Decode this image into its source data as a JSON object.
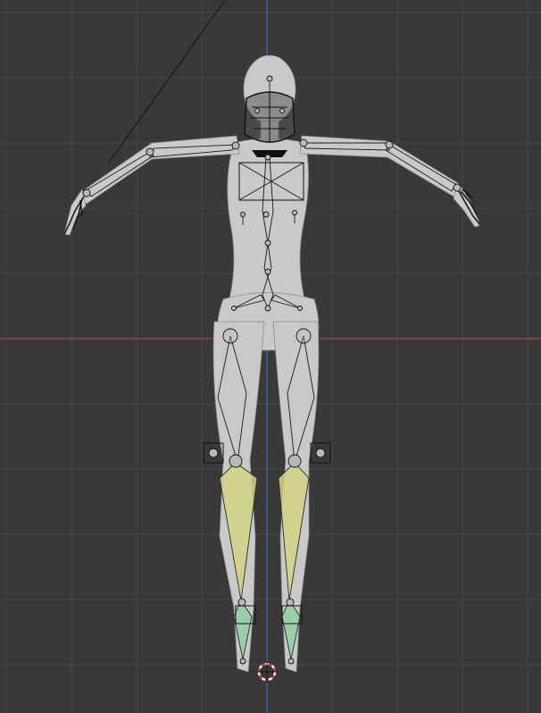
{
  "viewport": {
    "view": "front-orthographic",
    "grid": true,
    "colors": {
      "background": "#393939",
      "grid_line": "#474747",
      "x_axis": "#b03c45",
      "z_axis": "#3f6fb8",
      "mesh": "#c9c9c9",
      "bone_outline": "#1a1a1a",
      "selected_bone": "#d2d483",
      "ik_bone": "#8fd0a2"
    }
  },
  "scene": {
    "objects": [
      {
        "name_icon": "armature-icon",
        "kind": "armature"
      },
      {
        "name_icon": "mesh-icon",
        "kind": "character-mesh"
      },
      {
        "name_icon": "3d-cursor-icon",
        "kind": "3d-cursor"
      }
    ]
  }
}
